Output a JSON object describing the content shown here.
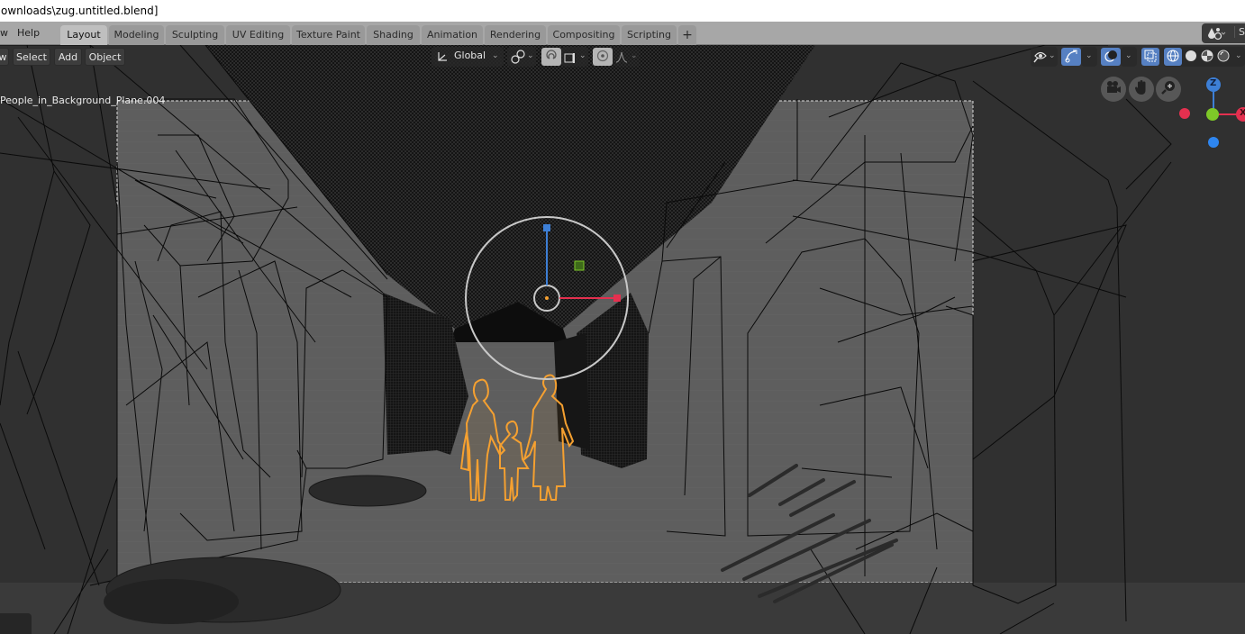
{
  "window": {
    "title": "ownloads\\zug.untitled.blend]"
  },
  "topbar": {
    "menus": [
      {
        "label": "w"
      },
      {
        "label": "Help"
      }
    ],
    "workspace_tabs": [
      {
        "label": "Layout",
        "active": true
      },
      {
        "label": "Modeling",
        "active": false
      },
      {
        "label": "Sculpting",
        "active": false
      },
      {
        "label": "UV Editing",
        "active": false
      },
      {
        "label": "Texture Paint",
        "active": false
      },
      {
        "label": "Shading",
        "active": false
      },
      {
        "label": "Animation",
        "active": false
      },
      {
        "label": "Rendering",
        "active": false
      },
      {
        "label": "Compositing",
        "active": false
      },
      {
        "label": "Scripting",
        "active": false
      }
    ],
    "add_workspace_label": "+",
    "scene_label": "S"
  },
  "viewport_header": {
    "menus": [
      {
        "label": "w"
      },
      {
        "label": "Select"
      },
      {
        "label": "Add"
      },
      {
        "label": "Object"
      }
    ],
    "transform_orientation": "Global",
    "icons": {
      "orientation": "transform-axes-icon",
      "pivot": "pivot-point-icon",
      "snap": "snap-magnet-icon",
      "snap_target": "snap-increment-icon",
      "proportional": "proportional-edit-icon",
      "falloff": "falloff-curve-icon",
      "visibility": "object-visibility-icon",
      "gizmo": "gizmo-toggle-icon",
      "overlay": "overlay-toggle-icon",
      "xray": "xray-toggle-icon",
      "shading_wire": "wireframe-shading-icon",
      "shading_solid": "solid-shading-icon",
      "shading_material": "material-shading-icon",
      "shading_rendered": "rendered-shading-icon"
    }
  },
  "viewport": {
    "active_object_label": "People_in_Background_Plane.004",
    "nav_gizmo": {
      "z_label": "Z",
      "x_label": "X"
    },
    "colors": {
      "selection": "#f5a030",
      "axis_x": "#e4304f",
      "axis_y": "#7ec828",
      "axis_z": "#3d7fd6",
      "gizmo_ring": "#c8c8c8",
      "background": "#303030",
      "camera_frame_fill": "#5e5e5e"
    }
  }
}
